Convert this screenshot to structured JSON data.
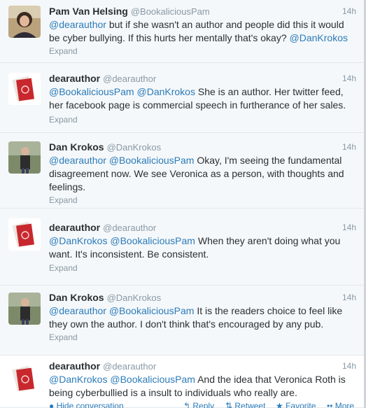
{
  "tweets": [
    {
      "name": "Pam Van Helsing",
      "handle": "@BookaliciousPam",
      "time": "14h",
      "avatar": "photo-avatar-woman",
      "mentions_start": [
        "@dearauthor"
      ],
      "text": " but if she wasn't an author and people did this it would be cyber bullying. If this hurts her mentally that's okay? ",
      "mention_end": "@DanKrokos",
      "expand": "Expand"
    },
    {
      "name": "dearauthor",
      "handle": "@dearauthor",
      "time": "14h",
      "avatar": "red-card-avatar",
      "mentions_start": [
        "@BookaliciousPam",
        "@DanKrokos"
      ],
      "text": " She is an author. Her twitter feed, her facebook page is commercial speech in furtherance of her sales.",
      "expand": "Expand"
    },
    {
      "name": "Dan Krokos",
      "handle": "@DanKrokos",
      "time": "14h",
      "avatar": "photo-avatar-man",
      "mentions_start": [
        "@dearauthor",
        "@BookaliciousPam"
      ],
      "text": " Okay, I'm seeing the fundamental disagreement now. We see Veronica as a person, with thoughts and feelings.",
      "expand": "Expand"
    },
    {
      "name": "dearauthor",
      "handle": "@dearauthor",
      "time": "14h",
      "avatar": "red-card-avatar",
      "mentions_start": [
        "@DanKrokos",
        "@BookaliciousPam"
      ],
      "text": " When they aren't doing what you want. It's inconsistent.  Be consistent.",
      "expand": "Expand"
    },
    {
      "name": "Dan Krokos",
      "handle": "@DanKrokos",
      "time": "14h",
      "avatar": "photo-avatar-man",
      "mentions_start": [
        "@dearauthor",
        "@BookaliciousPam"
      ],
      "text": " It is the readers choice to feel like they own the author. I don't think that's encouraged by any pub.",
      "expand": "Expand"
    },
    {
      "name": "dearauthor",
      "handle": "@dearauthor",
      "time": "14h",
      "avatar": "red-card-avatar",
      "mentions_start": [
        "@DanKrokos",
        "@BookaliciousPam"
      ],
      "text": " And the idea that Veronica Roth is being cyberbullied is a insult to individuals who really are.",
      "actions": {
        "hide": "Hide conversation",
        "reply": "Reply",
        "retweet": "Retweet",
        "favorite": "Favorite",
        "more": "More"
      }
    }
  ]
}
